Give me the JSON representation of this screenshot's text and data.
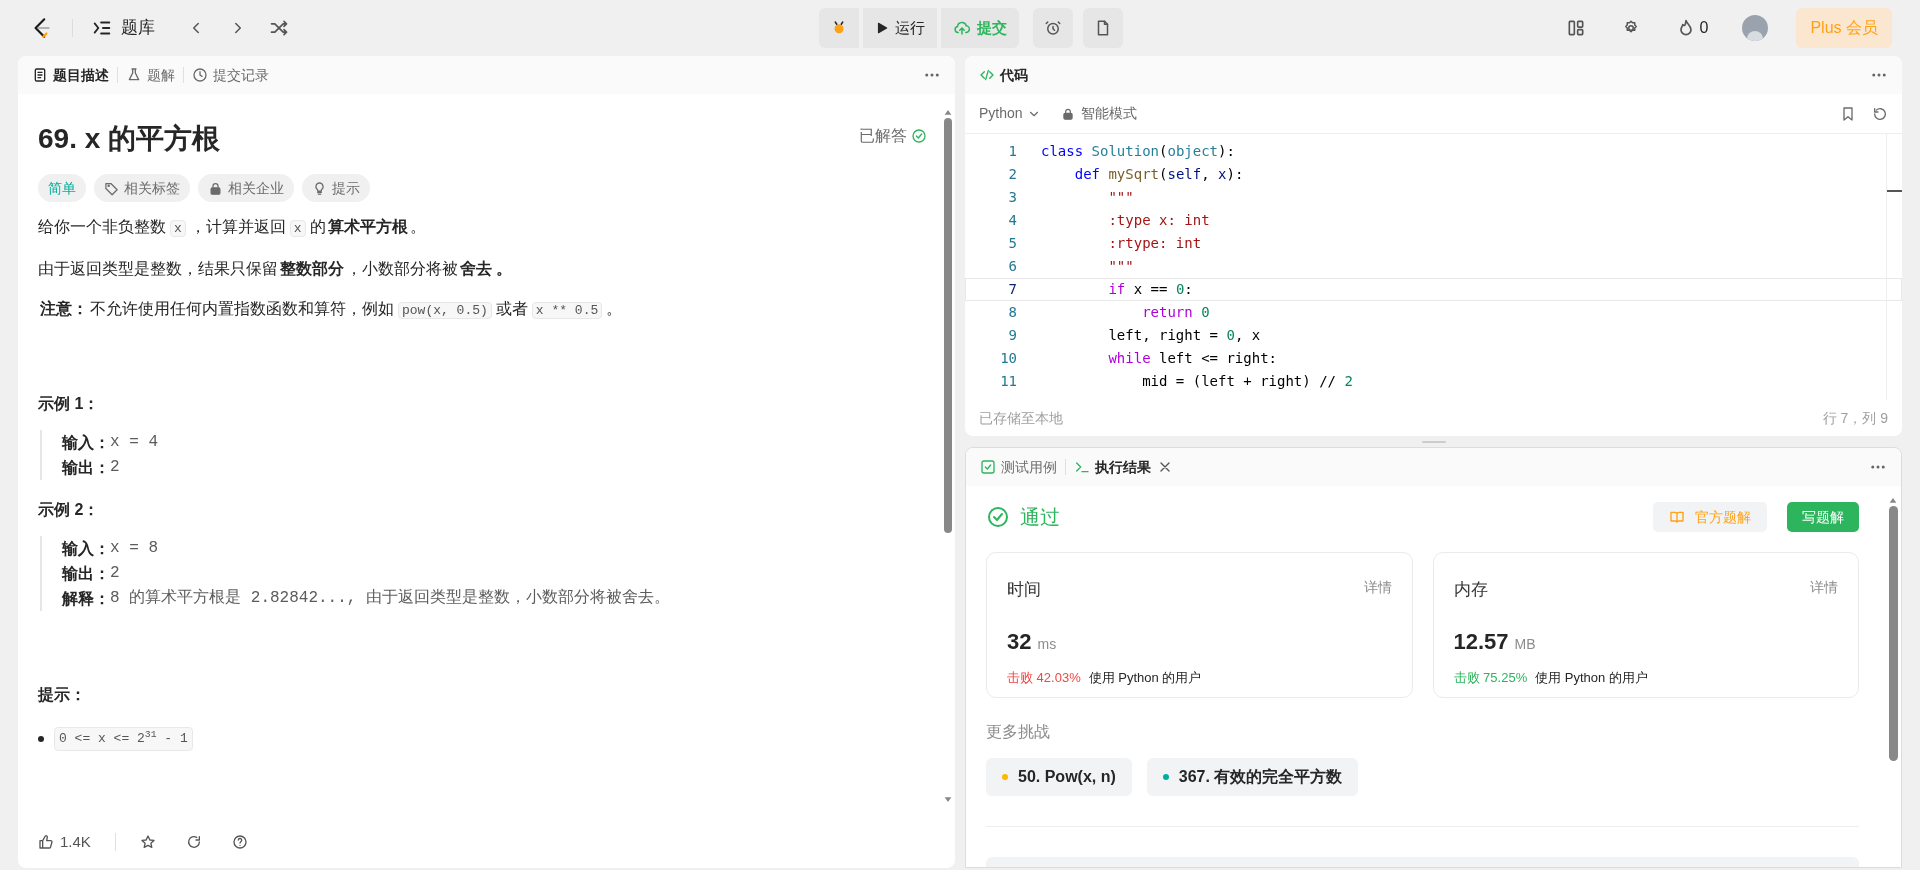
{
  "top_bar": {
    "nav_label": "题库",
    "run": "运行",
    "submit": "提交",
    "streak": "0",
    "plus": "Plus 会员"
  },
  "left_panel": {
    "tabs": [
      {
        "label": "题目描述",
        "selected": true,
        "kind": "doc"
      },
      {
        "label": "题解",
        "selected": false,
        "kind": "flask"
      },
      {
        "label": "提交记录",
        "selected": false,
        "kind": "clock"
      }
    ],
    "title": "69. x 的平方根",
    "status": "已解答",
    "tags": [
      {
        "label": "简单",
        "kind": "difficulty"
      },
      {
        "label": "相关标签",
        "kind": "tag"
      },
      {
        "label": "相关企业",
        "kind": "lock"
      },
      {
        "label": "提示",
        "kind": "bulb"
      }
    ],
    "paragraphs": [
      [
        {
          "kind": "text",
          "text": "给你一个非负整数"
        },
        {
          "kind": "code",
          "text": "x"
        },
        {
          "kind": "text",
          "text": "，计算并返回"
        },
        {
          "kind": "code",
          "text": "x"
        },
        {
          "kind": "text",
          "text": "的"
        },
        {
          "kind": "bold",
          "text": "算术平方根"
        },
        {
          "kind": "text",
          "text": "。"
        }
      ],
      [
        {
          "kind": "text",
          "text": "由于返回类型是整数，结果只保留"
        },
        {
          "kind": "bold",
          "text": "整数部分"
        },
        {
          "kind": "text",
          "text": "，小数部分将被"
        },
        {
          "kind": "bold",
          "text": "舍去 。"
        }
      ],
      [
        {
          "kind": "bold",
          "text": "注意："
        },
        {
          "kind": "text",
          "text": "不允许使用任何内置指数函数和算符，例如"
        },
        {
          "kind": "code",
          "text": "pow(x, 0.5)"
        },
        {
          "kind": "text",
          "text": "或者"
        },
        {
          "kind": "code",
          "text": "x ** 0.5"
        },
        {
          "kind": "text",
          "text": "。"
        }
      ]
    ],
    "examples": [
      {
        "title": "示例 1：",
        "lines": [
          {
            "label": "输入：",
            "value": "x = 4"
          },
          {
            "label": "输出：",
            "value": "2"
          }
        ]
      },
      {
        "title": "示例 2：",
        "lines": [
          {
            "label": "输入：",
            "value": "x = 8"
          },
          {
            "label": "输出：",
            "value": "2"
          },
          {
            "label": "解释：",
            "value": "8 的算术平方根是 2.82842..., 由于返回类型是整数，小数部分将被舍去。"
          }
        ]
      }
    ],
    "hints_title": "提示：",
    "constraints": [
      "0 <= x <= 2$^{31}$ - 1"
    ],
    "likes": "1.4K"
  },
  "code_panel": {
    "tab": "代码",
    "language": "Python",
    "mode": "智能模式",
    "lines": [
      {
        "number": "1",
        "current": false,
        "tokens": [
          {
            "kind": "kw",
            "text": "class "
          },
          {
            "kind": "cls",
            "text": "Solution"
          },
          {
            "kind": "p",
            "text": "("
          },
          {
            "kind": "cls",
            "text": "object"
          },
          {
            "kind": "p",
            "text": "):"
          }
        ]
      },
      {
        "number": "2",
        "current": false,
        "tokens": [
          {
            "kind": "kw",
            "text": "    def "
          },
          {
            "kind": "fn",
            "text": "mySqrt"
          },
          {
            "kind": "p",
            "text": "("
          },
          {
            "kind": "var",
            "text": "self"
          },
          {
            "kind": "p",
            "text": ", "
          },
          {
            "kind": "var",
            "text": "x"
          },
          {
            "kind": "p",
            "text": "):"
          }
        ]
      },
      {
        "number": "3",
        "current": false,
        "tokens": [
          {
            "kind": "str",
            "text": "        \"\"\""
          }
        ]
      },
      {
        "number": "4",
        "current": false,
        "tokens": [
          {
            "kind": "str",
            "text": "        :type x: int"
          }
        ]
      },
      {
        "number": "5",
        "current": false,
        "tokens": [
          {
            "kind": "str",
            "text": "        :rtype: int"
          }
        ]
      },
      {
        "number": "6",
        "current": false,
        "tokens": [
          {
            "kind": "str",
            "text": "        \"\"\""
          }
        ]
      },
      {
        "number": "7",
        "current": true,
        "tokens": [
          {
            "kind": "ctl",
            "text": "        if"
          },
          {
            "kind": "p",
            "text": " x == "
          },
          {
            "kind": "num",
            "text": "0"
          },
          {
            "kind": "p",
            "text": ":"
          }
        ]
      },
      {
        "number": "8",
        "current": false,
        "tokens": [
          {
            "kind": "ctl",
            "text": "            return "
          },
          {
            "kind": "num",
            "text": "0"
          }
        ]
      },
      {
        "number": "9",
        "current": false,
        "tokens": [
          {
            "kind": "p",
            "text": "        left, right = "
          },
          {
            "kind": "num",
            "text": "0"
          },
          {
            "kind": "p",
            "text": ", x"
          }
        ]
      },
      {
        "number": "10",
        "current": false,
        "tokens": [
          {
            "kind": "ctl",
            "text": "        while"
          },
          {
            "kind": "p",
            "text": " left <= right:"
          }
        ]
      },
      {
        "number": "11",
        "current": false,
        "tokens": [
          {
            "kind": "p",
            "text": "            mid = (left + right) // "
          },
          {
            "kind": "num",
            "text": "2"
          }
        ]
      }
    ],
    "saved": "已存储至本地",
    "cursor": "行 7，列 9"
  },
  "result_panel": {
    "tabs": [
      {
        "label": "测试用例",
        "selected": false,
        "kind": "check",
        "closable": false
      },
      {
        "label": "执行结果",
        "selected": true,
        "kind": "terminal",
        "closable": true
      }
    ],
    "status": "通过",
    "solution_button": "官方题解",
    "write_button": "写题解",
    "cards": [
      {
        "title": "时间",
        "detail": "详情",
        "value": "32",
        "unit": "ms",
        "beat": "击败 42.03%",
        "color": "#ef4743",
        "suffix": "使用 Python 的用户"
      },
      {
        "title": "内存",
        "detail": "详情",
        "value": "12.57",
        "unit": "MB",
        "beat": "击败 75.25%",
        "color": "#2db55d",
        "suffix": "使用 Python 的用户"
      }
    ],
    "more_title": "更多挑战",
    "challenges": [
      {
        "label": "50. Pow(x, n)",
        "color": "#ffb800"
      },
      {
        "label": "367. 有效的完全平方数",
        "color": "#00af9b"
      }
    ]
  }
}
